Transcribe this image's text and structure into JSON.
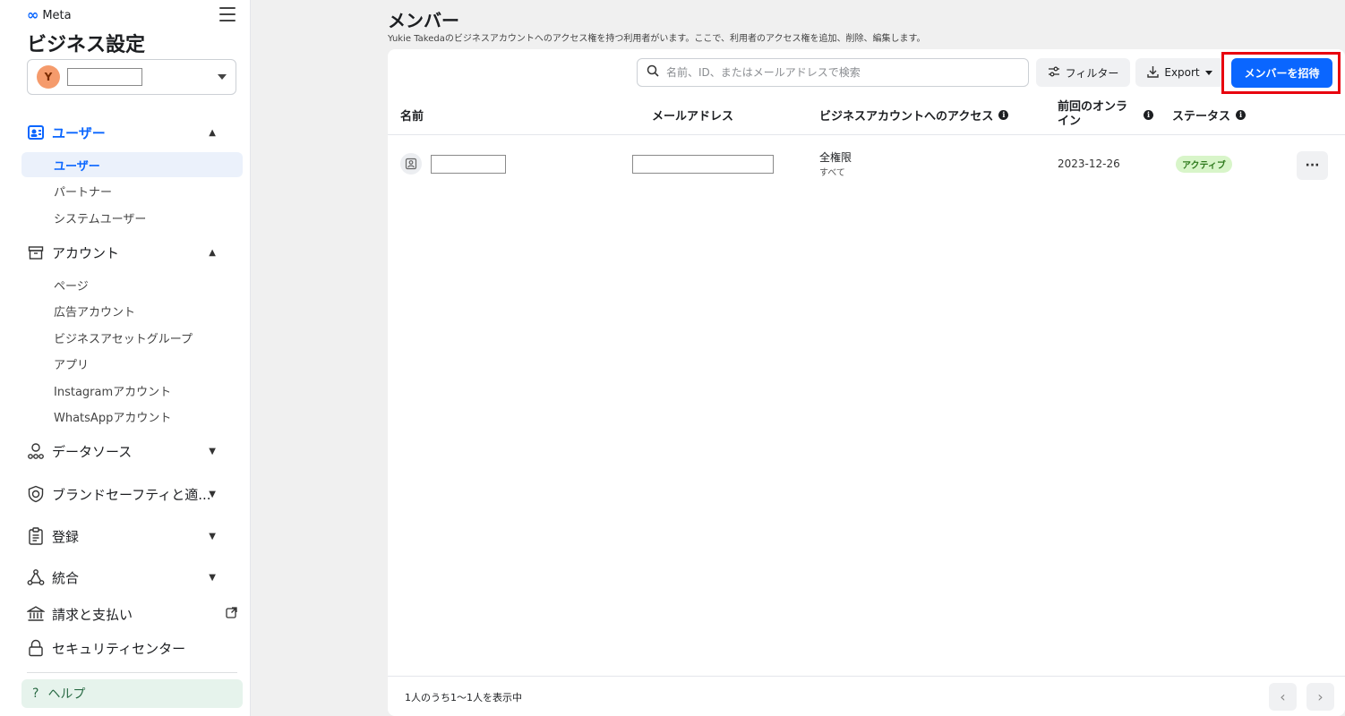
{
  "sidebar": {
    "brand": "Meta",
    "title": "ビジネス設定",
    "account_avatar": "Y",
    "sections": {
      "users": {
        "label": "ユーザー",
        "items": [
          "ユーザー",
          "パートナー",
          "システムユーザー"
        ]
      },
      "accounts": {
        "label": "アカウント",
        "items": [
          "ページ",
          "広告アカウント",
          "ビジネスアセットグループ",
          "アプリ",
          "Instagramアカウント",
          "WhatsAppアカウント"
        ]
      },
      "datasources": {
        "label": "データソース"
      },
      "brandsafety": {
        "label": "ブランドセーフティと適..."
      },
      "registration": {
        "label": "登録"
      },
      "integrations": {
        "label": "統合"
      },
      "billing": {
        "label": "請求と支払い"
      },
      "security": {
        "label": "セキュリティセンター"
      }
    },
    "help": {
      "icon": "?",
      "label": "ヘルプ"
    }
  },
  "main": {
    "title": "メンバー",
    "description": "Yukie Takedaのビジネスアカウントへのアクセス権を持つ利用者がいます。ここで、利用者のアクセス権を追加、削除、編集します。",
    "search_placeholder": "名前、ID、またはメールアドレスで検索",
    "filter_label": "フィルター",
    "export_label": "Export",
    "invite_label": "メンバーを招待",
    "columns": {
      "name": "名前",
      "email": "メールアドレス",
      "access": "ビジネスアカウントへのアクセス",
      "last_online": "前回のオンライン",
      "status": "ステータス"
    },
    "rows": [
      {
        "access_level": "全権限",
        "access_scope": "すべて",
        "last_online": "2023-12-26",
        "status": "アクティブ",
        "more": "···"
      }
    ],
    "pagination_text": "1人のうち1〜1人を表示中",
    "prev": "‹",
    "next": "›"
  }
}
